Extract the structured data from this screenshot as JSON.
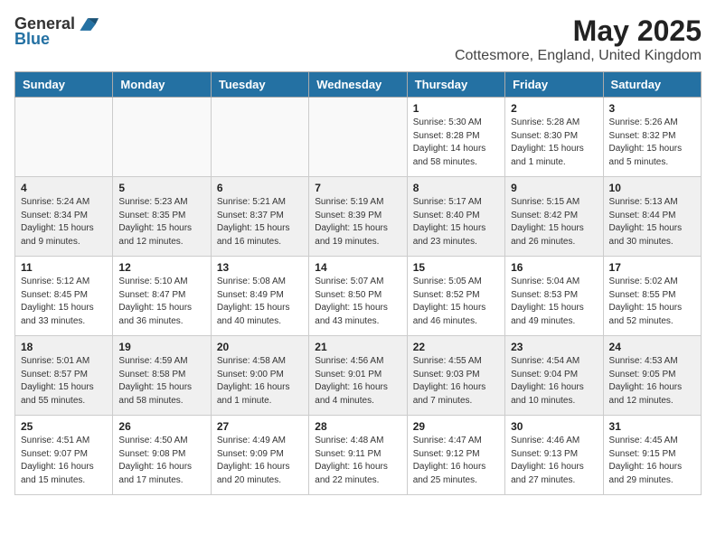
{
  "header": {
    "logo_general": "General",
    "logo_blue": "Blue",
    "month_title": "May 2025",
    "location": "Cottesmore, England, United Kingdom"
  },
  "weekdays": [
    "Sunday",
    "Monday",
    "Tuesday",
    "Wednesday",
    "Thursday",
    "Friday",
    "Saturday"
  ],
  "weeks": [
    [
      {
        "day": "",
        "detail": ""
      },
      {
        "day": "",
        "detail": ""
      },
      {
        "day": "",
        "detail": ""
      },
      {
        "day": "",
        "detail": ""
      },
      {
        "day": "1",
        "detail": "Sunrise: 5:30 AM\nSunset: 8:28 PM\nDaylight: 14 hours\nand 58 minutes."
      },
      {
        "day": "2",
        "detail": "Sunrise: 5:28 AM\nSunset: 8:30 PM\nDaylight: 15 hours\nand 1 minute."
      },
      {
        "day": "3",
        "detail": "Sunrise: 5:26 AM\nSunset: 8:32 PM\nDaylight: 15 hours\nand 5 minutes."
      }
    ],
    [
      {
        "day": "4",
        "detail": "Sunrise: 5:24 AM\nSunset: 8:34 PM\nDaylight: 15 hours\nand 9 minutes."
      },
      {
        "day": "5",
        "detail": "Sunrise: 5:23 AM\nSunset: 8:35 PM\nDaylight: 15 hours\nand 12 minutes."
      },
      {
        "day": "6",
        "detail": "Sunrise: 5:21 AM\nSunset: 8:37 PM\nDaylight: 15 hours\nand 16 minutes."
      },
      {
        "day": "7",
        "detail": "Sunrise: 5:19 AM\nSunset: 8:39 PM\nDaylight: 15 hours\nand 19 minutes."
      },
      {
        "day": "8",
        "detail": "Sunrise: 5:17 AM\nSunset: 8:40 PM\nDaylight: 15 hours\nand 23 minutes."
      },
      {
        "day": "9",
        "detail": "Sunrise: 5:15 AM\nSunset: 8:42 PM\nDaylight: 15 hours\nand 26 minutes."
      },
      {
        "day": "10",
        "detail": "Sunrise: 5:13 AM\nSunset: 8:44 PM\nDaylight: 15 hours\nand 30 minutes."
      }
    ],
    [
      {
        "day": "11",
        "detail": "Sunrise: 5:12 AM\nSunset: 8:45 PM\nDaylight: 15 hours\nand 33 minutes."
      },
      {
        "day": "12",
        "detail": "Sunrise: 5:10 AM\nSunset: 8:47 PM\nDaylight: 15 hours\nand 36 minutes."
      },
      {
        "day": "13",
        "detail": "Sunrise: 5:08 AM\nSunset: 8:49 PM\nDaylight: 15 hours\nand 40 minutes."
      },
      {
        "day": "14",
        "detail": "Sunrise: 5:07 AM\nSunset: 8:50 PM\nDaylight: 15 hours\nand 43 minutes."
      },
      {
        "day": "15",
        "detail": "Sunrise: 5:05 AM\nSunset: 8:52 PM\nDaylight: 15 hours\nand 46 minutes."
      },
      {
        "day": "16",
        "detail": "Sunrise: 5:04 AM\nSunset: 8:53 PM\nDaylight: 15 hours\nand 49 minutes."
      },
      {
        "day": "17",
        "detail": "Sunrise: 5:02 AM\nSunset: 8:55 PM\nDaylight: 15 hours\nand 52 minutes."
      }
    ],
    [
      {
        "day": "18",
        "detail": "Sunrise: 5:01 AM\nSunset: 8:57 PM\nDaylight: 15 hours\nand 55 minutes."
      },
      {
        "day": "19",
        "detail": "Sunrise: 4:59 AM\nSunset: 8:58 PM\nDaylight: 15 hours\nand 58 minutes."
      },
      {
        "day": "20",
        "detail": "Sunrise: 4:58 AM\nSunset: 9:00 PM\nDaylight: 16 hours\nand 1 minute."
      },
      {
        "day": "21",
        "detail": "Sunrise: 4:56 AM\nSunset: 9:01 PM\nDaylight: 16 hours\nand 4 minutes."
      },
      {
        "day": "22",
        "detail": "Sunrise: 4:55 AM\nSunset: 9:03 PM\nDaylight: 16 hours\nand 7 minutes."
      },
      {
        "day": "23",
        "detail": "Sunrise: 4:54 AM\nSunset: 9:04 PM\nDaylight: 16 hours\nand 10 minutes."
      },
      {
        "day": "24",
        "detail": "Sunrise: 4:53 AM\nSunset: 9:05 PM\nDaylight: 16 hours\nand 12 minutes."
      }
    ],
    [
      {
        "day": "25",
        "detail": "Sunrise: 4:51 AM\nSunset: 9:07 PM\nDaylight: 16 hours\nand 15 minutes."
      },
      {
        "day": "26",
        "detail": "Sunrise: 4:50 AM\nSunset: 9:08 PM\nDaylight: 16 hours\nand 17 minutes."
      },
      {
        "day": "27",
        "detail": "Sunrise: 4:49 AM\nSunset: 9:09 PM\nDaylight: 16 hours\nand 20 minutes."
      },
      {
        "day": "28",
        "detail": "Sunrise: 4:48 AM\nSunset: 9:11 PM\nDaylight: 16 hours\nand 22 minutes."
      },
      {
        "day": "29",
        "detail": "Sunrise: 4:47 AM\nSunset: 9:12 PM\nDaylight: 16 hours\nand 25 minutes."
      },
      {
        "day": "30",
        "detail": "Sunrise: 4:46 AM\nSunset: 9:13 PM\nDaylight: 16 hours\nand 27 minutes."
      },
      {
        "day": "31",
        "detail": "Sunrise: 4:45 AM\nSunset: 9:15 PM\nDaylight: 16 hours\nand 29 minutes."
      }
    ]
  ]
}
